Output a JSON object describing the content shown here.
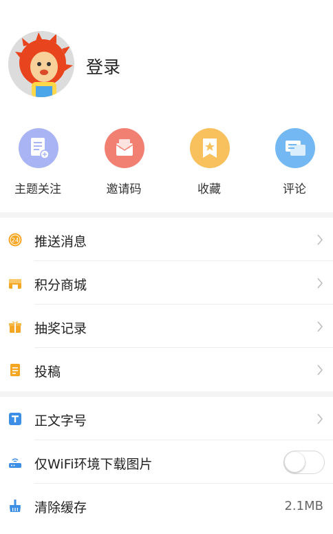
{
  "profile": {
    "login_label": "登录"
  },
  "actions": [
    {
      "label": "主题关注",
      "icon": "subscribe-doc-icon",
      "color": "#a9b4f4"
    },
    {
      "label": "邀请码",
      "icon": "invite-envelope-icon",
      "color": "#f28072"
    },
    {
      "label": "收藏",
      "icon": "bookmark-icon",
      "color": "#f9c05e"
    },
    {
      "label": "评论",
      "icon": "comment-icon",
      "color": "#73b8f2"
    }
  ],
  "menu": {
    "push": {
      "label": "推送消息",
      "icon": "clock-24-icon"
    },
    "mall": {
      "label": "积分商城",
      "icon": "store-icon"
    },
    "lottery": {
      "label": "抽奖记录",
      "icon": "gift-icon"
    },
    "contribute": {
      "label": "投稿",
      "icon": "notepad-icon"
    },
    "font_size": {
      "label": "正文字号",
      "icon": "text-size-icon"
    },
    "wifi_images": {
      "label": "仅WiFi环境下载图片",
      "icon": "router-icon",
      "enabled": false
    },
    "clear_cache": {
      "label": "清除缓存",
      "icon": "broom-icon",
      "value": "2.1MB"
    }
  },
  "colors": {
    "accent_orange": "#f5a623",
    "accent_blue": "#3d8fe6"
  }
}
